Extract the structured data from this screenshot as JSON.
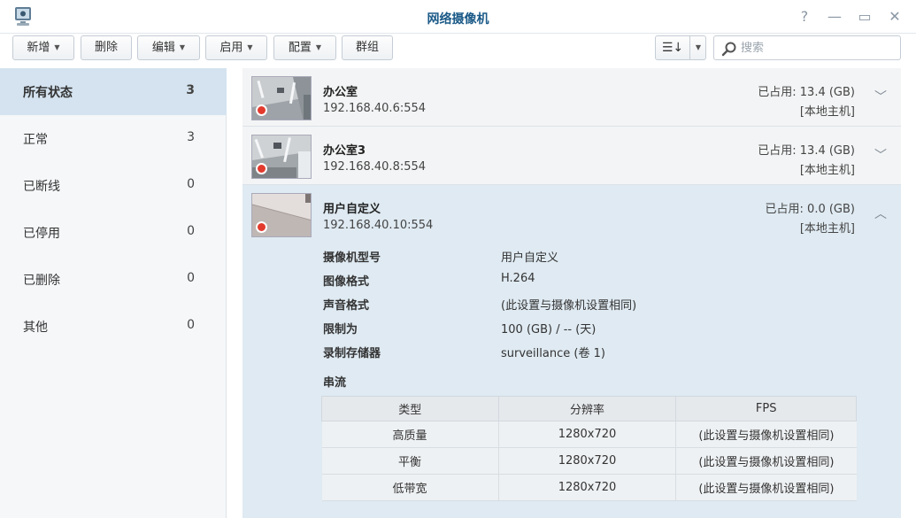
{
  "window": {
    "title": "网络摄像机"
  },
  "toolbar": {
    "new_label": "新增",
    "delete_label": "删除",
    "edit_label": "编辑",
    "enable_label": "启用",
    "config_label": "配置",
    "group_label": "群组"
  },
  "search": {
    "placeholder": "搜索",
    "value": ""
  },
  "sidebar": {
    "items": [
      {
        "label": "所有状态",
        "count": "3"
      },
      {
        "label": "正常",
        "count": "3"
      },
      {
        "label": "已断线",
        "count": "0"
      },
      {
        "label": "已停用",
        "count": "0"
      },
      {
        "label": "已删除",
        "count": "0"
      },
      {
        "label": "其他",
        "count": "0"
      }
    ]
  },
  "cameras": [
    {
      "name": "办公室",
      "ip": "192.168.40.6:554",
      "used": "已占用:  13.4 (GB)",
      "host": "[本地主机]"
    },
    {
      "name": "办公室3",
      "ip": "192.168.40.8:554",
      "used": "已占用:  13.4 (GB)",
      "host": "[本地主机]"
    },
    {
      "name": "用户自定义",
      "ip": "192.168.40.10:554",
      "used": "已占用:  0.0 (GB)",
      "host": "[本地主机]",
      "details": [
        {
          "key": "摄像机型号",
          "value": "用户自定义"
        },
        {
          "key": "图像格式",
          "value": "H.264"
        },
        {
          "key": "声音格式",
          "value": " (此设置与摄像机设置相同)"
        },
        {
          "key": "限制为",
          "value": "100 (GB) / -- (天)"
        },
        {
          "key": "录制存储器",
          "value": "surveillance (卷 1)"
        }
      ],
      "streams_label": "串流",
      "streams": {
        "headers": [
          "类型",
          "分辨率",
          "FPS"
        ],
        "rows": [
          [
            "高质量",
            "1280x720",
            "(此设置与摄像机设置相同)"
          ],
          [
            "平衡",
            "1280x720",
            "(此设置与摄像机设置相同)"
          ],
          [
            "低带宽",
            "1280x720",
            "(此设置与摄像机设置相同)"
          ]
        ]
      }
    }
  ],
  "colors": {
    "accent": "#1b5a88",
    "active_bg": "#d4e3ef",
    "record": "#e23b2e"
  }
}
